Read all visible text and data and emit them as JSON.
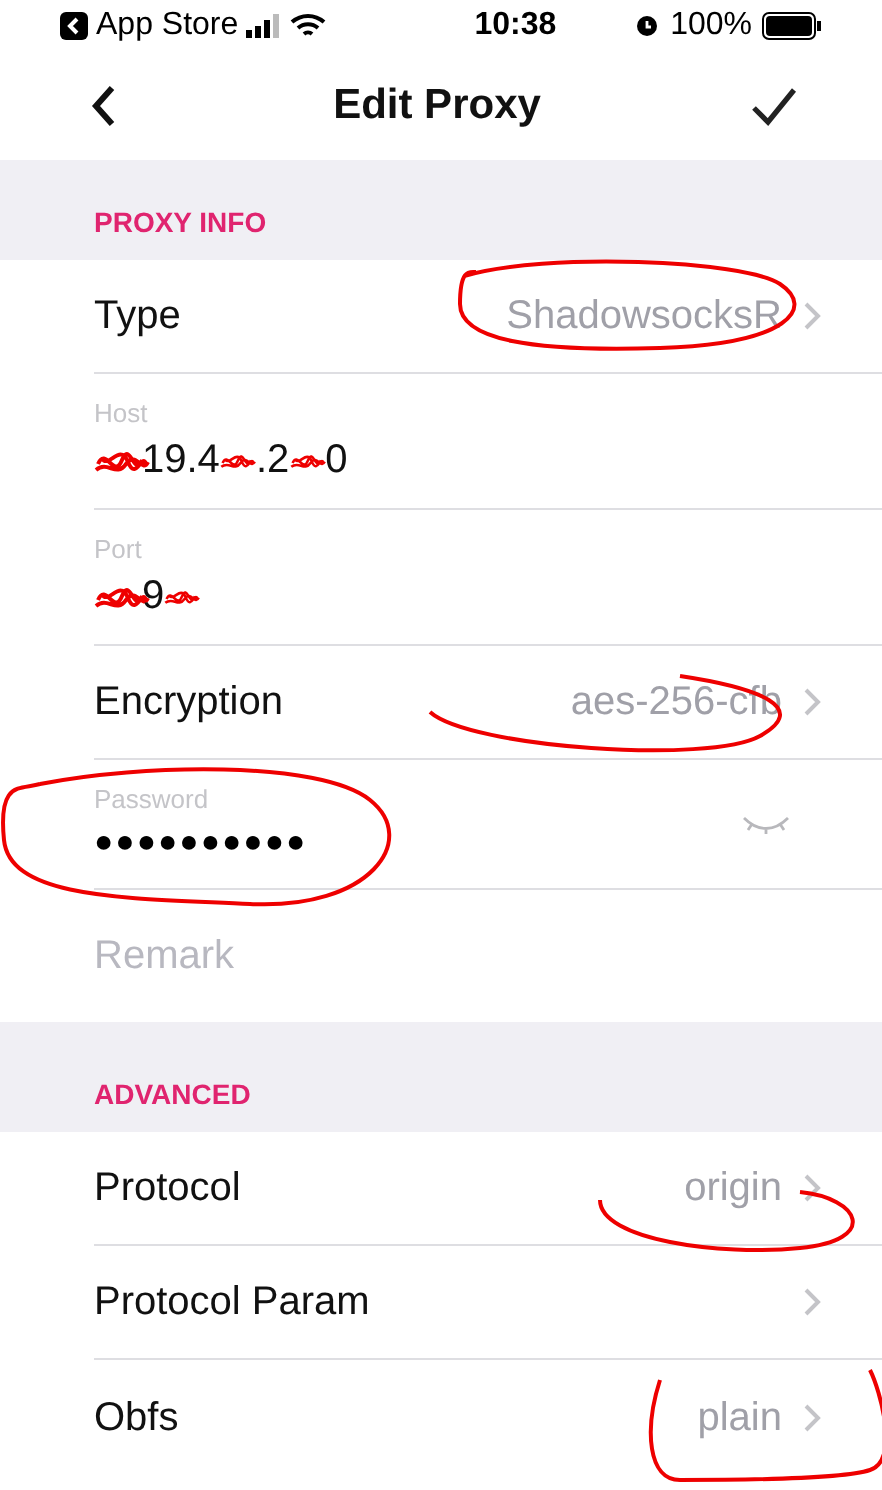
{
  "status_bar": {
    "back_app": "App Store",
    "time": "10:38",
    "battery": "100%"
  },
  "nav": {
    "title": "Edit Proxy"
  },
  "sections": [
    {
      "header": "PROXY INFO",
      "rows": [
        {
          "kind": "select",
          "label": "Type",
          "value": "ShadowsocksR"
        },
        {
          "kind": "field",
          "caption": "Host",
          "fragments": [
            "19.4",
            ".2",
            "0"
          ]
        },
        {
          "kind": "field",
          "caption": "Port",
          "fragments": [
            "9"
          ]
        },
        {
          "kind": "select",
          "label": "Encryption",
          "value": "aes-256-cfb"
        },
        {
          "kind": "secure",
          "caption": "Password",
          "value": "●●●●●●●●●●"
        },
        {
          "kind": "placeholder",
          "placeholder": "Remark"
        }
      ]
    },
    {
      "header": "ADVANCED",
      "rows": [
        {
          "kind": "select",
          "label": "Protocol",
          "value": "origin"
        },
        {
          "kind": "select",
          "label": "Protocol Param"
        },
        {
          "kind": "select",
          "label": "Obfs",
          "value": "plain"
        }
      ]
    }
  ]
}
